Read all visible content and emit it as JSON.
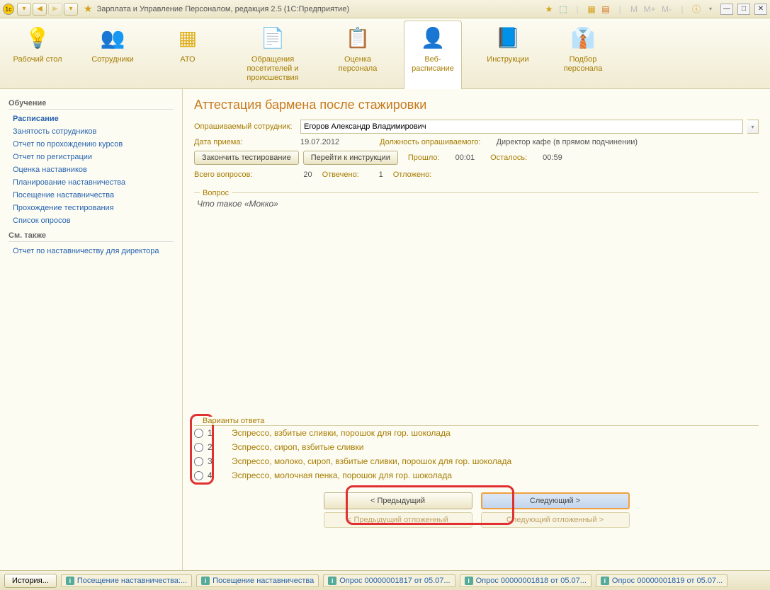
{
  "titlebar": {
    "title": "Зарплата и Управление Персоналом, редакция 2.5  (1С:Предприятие)",
    "m_labels": [
      "M",
      "M+",
      "M-"
    ]
  },
  "toolbar": {
    "items": [
      {
        "label": "Рабочий стол"
      },
      {
        "label": "Сотрудники"
      },
      {
        "label": "АТО"
      },
      {
        "label": "Обращения посетителей и происшествия"
      },
      {
        "label": "Оценка персонала"
      },
      {
        "label": "Веб-расписание"
      },
      {
        "label": "Инструкции"
      },
      {
        "label": "Подбор персонала"
      }
    ]
  },
  "sidebar": {
    "groups": [
      {
        "title": "Обучение",
        "items": [
          {
            "label": "Расписание",
            "active": true
          },
          {
            "label": "Занятость сотрудников"
          },
          {
            "label": "Отчет по прохождению курсов"
          },
          {
            "label": "Отчет по регистрации"
          },
          {
            "label": "Оценка наставников"
          },
          {
            "label": "Планирование наставничества"
          },
          {
            "label": "Посещение наставничества"
          },
          {
            "label": "Прохождение тестирования"
          },
          {
            "label": "Список опросов"
          }
        ]
      },
      {
        "title": "См. также",
        "items": [
          {
            "label": "Отчет по наставничеству для директора"
          }
        ]
      }
    ]
  },
  "page": {
    "title": "Аттестация бармена после стажировки",
    "employee_label": "Опрашиваемый сотрудник:",
    "employee_value": "Егоров Александр Владимирович",
    "date_label": "Дата приема:",
    "date_value": "19.07.2012",
    "position_label": "Должность опрашиваемого:",
    "position_value": "Директор кафе (в прямом подчинении)",
    "finish_btn": "Закончить тестирование",
    "goto_btn": "Перейти к инструкции",
    "elapsed_label": "Прошло:",
    "elapsed_value": "00:01",
    "remaining_label": "Осталось:",
    "remaining_value": "00:59",
    "total_q_label": "Всего вопросов:",
    "total_q_value": "20",
    "answered_label": "Отвечено:",
    "answered_value": "1",
    "postponed_label": "Отложено:",
    "question_header": "Вопрос",
    "question_text": "Что такое «Мокко»",
    "answers_header": "Варианты ответа",
    "answers": [
      {
        "num": "1",
        "text": "Эспрессо, взбитые сливки, порошок для гор. шоколада"
      },
      {
        "num": "2",
        "text": "Эспрессо, сироп, взбитые сливки"
      },
      {
        "num": "3",
        "text": "Эспрессо, молоко, сироп, взбитые сливки, порошок для гор. шоколада"
      },
      {
        "num": "4",
        "text": "Эспрессо, молочная пенка, порошок для гор. шоколада"
      }
    ],
    "prev_btn": "< Предыдущий",
    "next_btn": "Следующий >",
    "prev_postponed_btn": "< Предыдущий отложенный",
    "next_postponed_btn": "Следующий отложенный >"
  },
  "bottombar": {
    "history_btn": "История...",
    "items": [
      "Посещение наставничества:...",
      "Посещение наставничества",
      "Опрос 00000001817 от 05.07...",
      "Опрос 00000001818 от 05.07...",
      "Опрос 00000001819 от 05.07..."
    ]
  }
}
